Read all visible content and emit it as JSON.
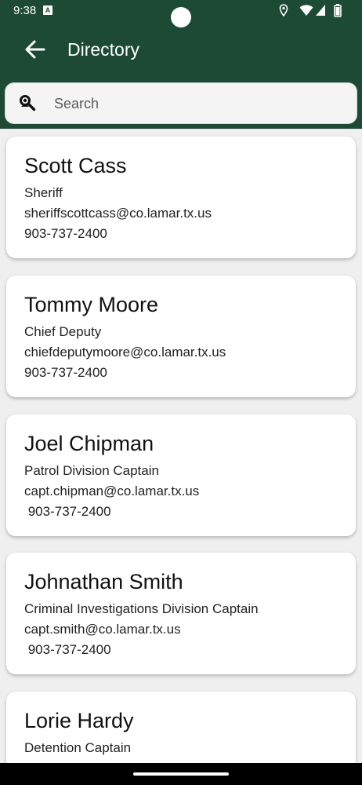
{
  "status_bar": {
    "time": "9:38",
    "notification_icon": "a-badge-icon",
    "icons": [
      "location-icon",
      "wifi-icon",
      "signal-icon",
      "battery-icon"
    ]
  },
  "app_bar": {
    "title": "Directory",
    "back_icon": "arrow-back-icon",
    "color": "#1d4a35"
  },
  "search": {
    "placeholder": "Search",
    "icon": "person-search-icon"
  },
  "contacts": [
    {
      "name": "Scott Cass",
      "title": "Sheriff",
      "email": "sheriffscottcass@co.lamar.tx.us",
      "phone": "903-737-2400"
    },
    {
      "name": "Tommy Moore",
      "title": "Chief Deputy",
      "email": "chiefdeputymoore@co.lamar.tx.us",
      "phone": "903-737-2400"
    },
    {
      "name": "Joel Chipman",
      "title": "Patrol Division Captain",
      "email": "capt.chipman@co.lamar.tx.us",
      "phone": " 903-737-2400"
    },
    {
      "name": "Johnathan Smith",
      "title": "Criminal Investigations Division Captain",
      "email": "capt.smith@co.lamar.tx.us",
      "phone": " 903-737-2400"
    },
    {
      "name": "Lorie Hardy",
      "title": "Detention Captain",
      "email": "",
      "phone": ""
    }
  ]
}
